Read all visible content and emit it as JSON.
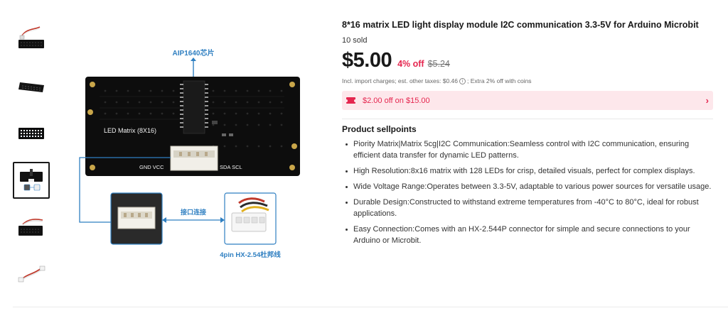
{
  "gallery": {
    "selected_index": 3,
    "thumbnails": [
      {
        "icon": "module-with-cable-thumbnail"
      },
      {
        "icon": "module-side-view-thumbnail"
      },
      {
        "icon": "led-lit-module-thumbnail"
      },
      {
        "icon": "diagram-thumbnail"
      },
      {
        "icon": "module-with-cable-thumbnail"
      },
      {
        "icon": "cable-thumbnail"
      }
    ],
    "main_image": {
      "chip_label": "AIP1640芯片",
      "board_label": "LED Matrix (8X16)",
      "pin_labels_left": "GND  VCC",
      "pin_labels_right": "SDA  SCL",
      "connect_label": "接口连接",
      "connector_label": "4pin HX-2.54杜邦线"
    }
  },
  "product": {
    "title": "8*16 matrix LED light display module I2C communication 3.3-5V for Arduino Microbit",
    "sold": "10 sold",
    "price": "$5.00",
    "discount": "4% off",
    "original_price": "$5.24",
    "tax_before": "Incl. import charges; est. other taxes: $0.46",
    "tax_after": "; Extra 2% off with coins",
    "coupon": "$2.00 off on $15.00"
  },
  "sellpoints": {
    "heading": "Product sellpoints",
    "items": [
      "Piority Matrix|Matrix 5cg|I2C Communication:Seamless control with I2C communication, ensuring efficient data transfer for dynamic LED patterns.",
      "High Resolution:8x16 matrix with 128 LEDs for crisp, detailed visuals, perfect for complex displays.",
      "Wide Voltage Range:Operates between 3.3-5V, adaptable to various power sources for versatile usage.",
      "Durable Design:Constructed to withstand extreme temperatures from -40°C to 80°C, ideal for robust applications.",
      "Easy Connection:Comes with an HX-2.544P connector for simple and secure connections to your Arduino or Microbit."
    ]
  },
  "colors": {
    "accent": "#e5264f",
    "coupon_bg": "#fde7eb",
    "diagram_blue": "#2f7fc1"
  }
}
